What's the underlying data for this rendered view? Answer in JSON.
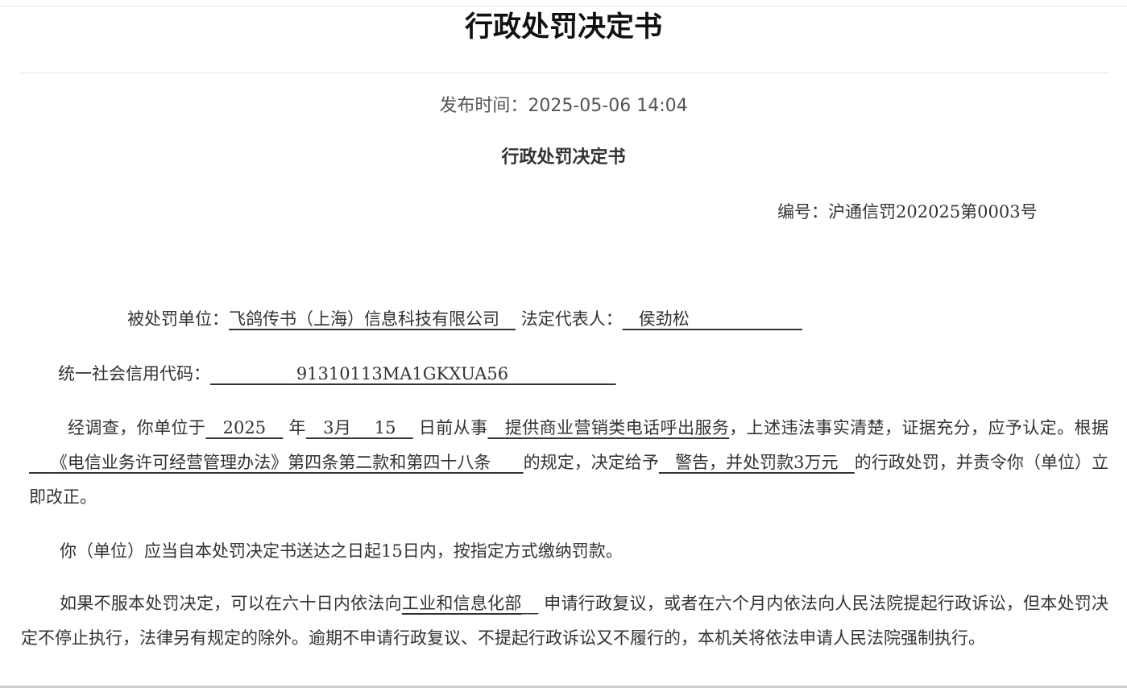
{
  "page": {
    "title": "行政处罚决定书",
    "publish_label": "发布时间：",
    "publish_time": "2025-05-06 14:04"
  },
  "document": {
    "title": "行政处罚决定书",
    "number_label": "编号：",
    "number": "沪通信罚202025第0003号",
    "penalized_unit_label": "被处罚单位：",
    "penalized_unit": "飞鸽传书（上海）信息科技有限公司",
    "legal_rep_label": "法定代表人：",
    "legal_rep": "侯劲松",
    "credit_code_label": "统一社会信用代码：",
    "credit_code": "91310113MA1GKXUA56",
    "p1": {
      "prefix": "经调查，你单位于",
      "year": "2025",
      "year_label": "年",
      "month": "3月",
      "day": "15",
      "day_label": "日前从事",
      "activity": "提供商业营销类电话呼出服务",
      "mid1": "，上述违法事实清楚，证据充分，应予认定。根据",
      "law": "《电信业务许可经营管理办法》第四条第二款和第四十八条",
      "mid2": "的规定，决定给予",
      "penalty": "警告，并处罚款3万元",
      "suffix": "的行政处罚，并责令你（单位）立即改正。"
    },
    "p2": "你（单位）应当自本处罚决定书送达之日起15日内，按指定方式缴纳罚款。",
    "p3": {
      "prefix": "如果不服本处罚决定，可以在六十日内依法向",
      "authority": "工业和信息化部",
      "suffix": "申请行政复议，或者在六个月内依法向人民法院提起行政诉讼，但本处罚决定不停止执行，法律另有规定的除外。逾期不申请行政复议、不提起行政诉讼又不履行的，本机关将依法申请人民法院强制执行。"
    }
  }
}
